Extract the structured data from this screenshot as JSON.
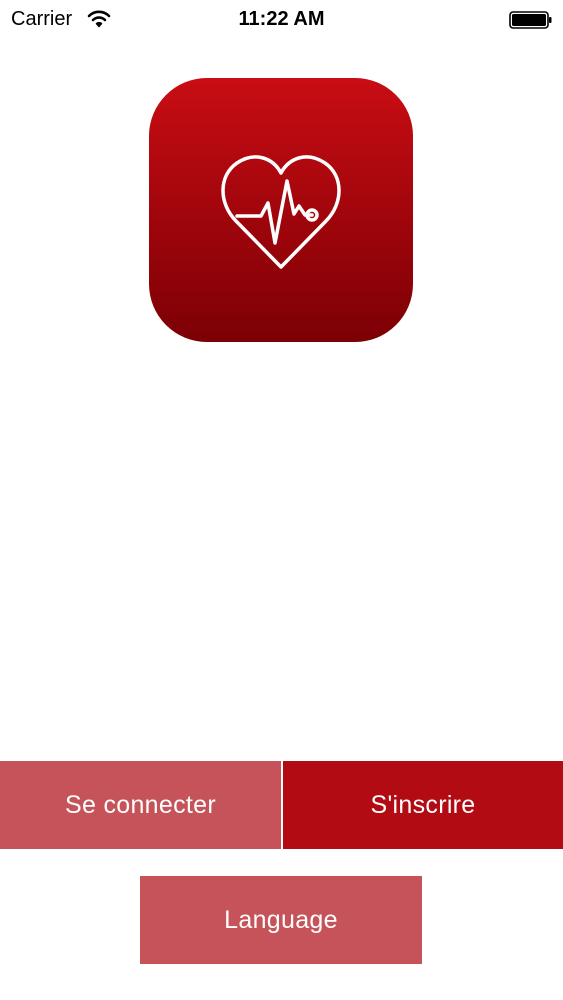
{
  "status_bar": {
    "carrier": "Carrier",
    "time": "11:22 AM",
    "wifi_icon": "wifi-icon",
    "battery_icon": "battery-icon"
  },
  "app_icon": {
    "icon": "heart-pulse-stethoscope-icon",
    "gradient_top": "#c90d14",
    "gradient_bottom": "#7c0005"
  },
  "buttons": {
    "login_label": "Se connecter",
    "signup_label": "S'inscrire",
    "language_label": "Language"
  },
  "colors": {
    "light_red": "#c6535a",
    "dark_red": "#b20b14",
    "background": "#ffffff"
  }
}
